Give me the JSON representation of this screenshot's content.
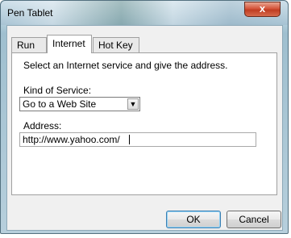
{
  "window": {
    "title": "Pen Tablet",
    "close_label": "x"
  },
  "tabs": [
    {
      "label": "Run",
      "active": false
    },
    {
      "label": "Internet",
      "active": true
    },
    {
      "label": "Hot Key",
      "active": false
    }
  ],
  "panel": {
    "description": "Select an Internet service and give the address.",
    "service_label": "Kind of Service:",
    "service_value": "Go to a Web Site",
    "address_label": "Address:",
    "address_value": "http://www.yahoo.com/"
  },
  "buttons": {
    "ok": "OK",
    "cancel": "Cancel"
  },
  "icons": {
    "dropdown": "chevron-down-icon",
    "close": "close-icon"
  }
}
